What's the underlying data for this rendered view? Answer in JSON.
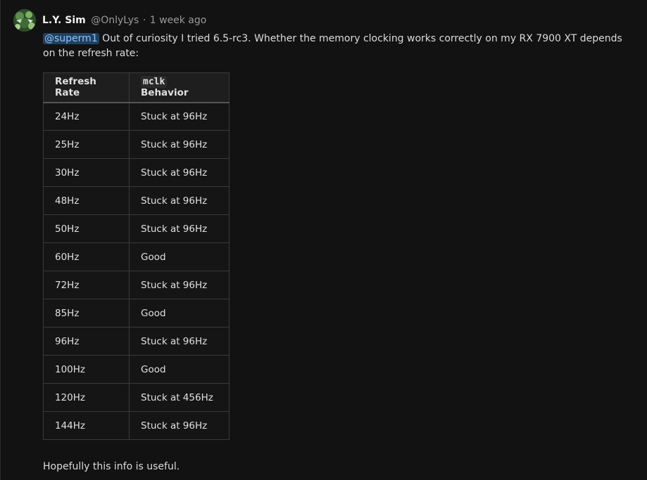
{
  "comment": {
    "author_name": "L.Y. Sim",
    "author_handle": "@OnlyLys",
    "separator": "·",
    "timestamp": "1 week ago",
    "mention": "@superm1",
    "body_text": " Out of curiosity I tried 6.5-rc3. Whether the memory clocking works correctly on my RX 7900 XT depends on the refresh rate:",
    "footer_text": "Hopefully this info is useful.",
    "avatar_icon": "avatar-icon",
    "mention_color": "#8ec3ff",
    "mention_bg": "#21405e"
  },
  "table": {
    "headers": {
      "col1": "Refresh Rate",
      "col2_code": "mclk",
      "col2_rest": " Behavior"
    },
    "rows": [
      {
        "rate": "24Hz",
        "behavior": "Stuck at 96Hz"
      },
      {
        "rate": "25Hz",
        "behavior": "Stuck at 96Hz"
      },
      {
        "rate": "30Hz",
        "behavior": "Stuck at 96Hz"
      },
      {
        "rate": "48Hz",
        "behavior": "Stuck at 96Hz"
      },
      {
        "rate": "50Hz",
        "behavior": "Stuck at 96Hz"
      },
      {
        "rate": "60Hz",
        "behavior": "Good"
      },
      {
        "rate": "72Hz",
        "behavior": "Stuck at 96Hz"
      },
      {
        "rate": "85Hz",
        "behavior": "Good"
      },
      {
        "rate": "96Hz",
        "behavior": "Stuck at 96Hz"
      },
      {
        "rate": "100Hz",
        "behavior": "Good"
      },
      {
        "rate": "120Hz",
        "behavior": "Stuck at 456Hz"
      },
      {
        "rate": "144Hz",
        "behavior": "Stuck at 96Hz"
      }
    ]
  }
}
